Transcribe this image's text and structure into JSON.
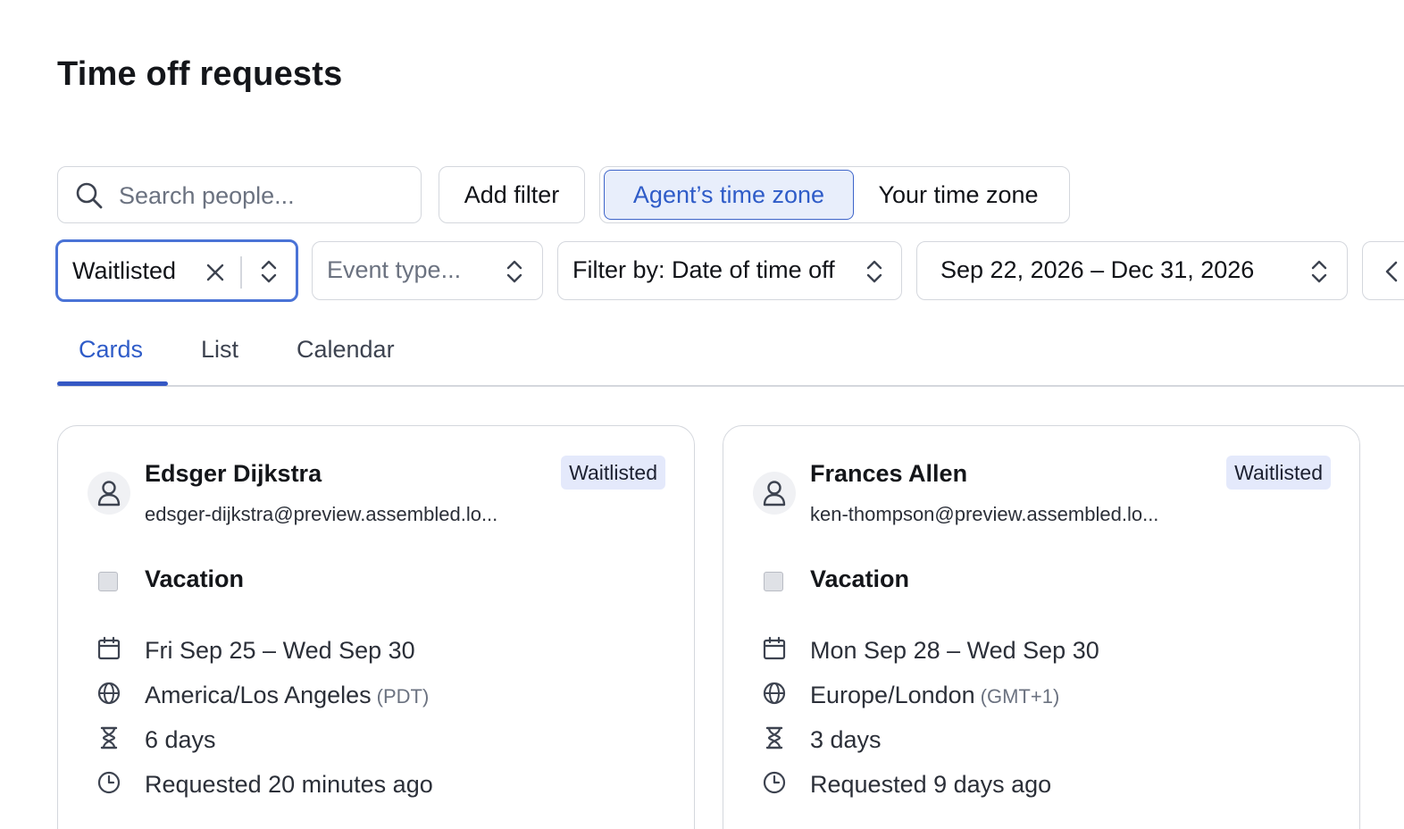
{
  "page": {
    "title": "Time off requests"
  },
  "toolbar": {
    "search_placeholder": "Search people...",
    "search_value": "",
    "add_filter_label": "Add filter",
    "timezone_options": [
      "Agent’s time zone",
      "Your time zone"
    ],
    "timezone_selected": "Agent’s time zone"
  },
  "filters": {
    "status_value": "Waitlisted",
    "event_type_placeholder": "Event type...",
    "filter_by_value": "Filter by: Date of time off",
    "date_range_value": "Sep 22, 2026 – Dec 31, 2026"
  },
  "tabs": [
    {
      "label": "Cards",
      "active": true
    },
    {
      "label": "List",
      "active": false
    },
    {
      "label": "Calendar",
      "active": false
    }
  ],
  "cards": [
    {
      "name": "Edsger Dijkstra",
      "email": "edsger-dijkstra@preview.assembled.lo...",
      "status": "Waitlisted",
      "type": "Vacation",
      "dates": "Fri Sep 25 – Wed Sep 30",
      "timezone": "America/Los Angeles",
      "timezone_abbr": "(PDT)",
      "duration": "6 days",
      "requested": "Requested 20 minutes ago"
    },
    {
      "name": "Frances Allen",
      "email": "ken-thompson@preview.assembled.lo...",
      "status": "Waitlisted",
      "type": "Vacation",
      "dates": "Mon Sep 28 – Wed Sep 30",
      "timezone": "Europe/London",
      "timezone_abbr": "(GMT+1)",
      "duration": "3 days",
      "requested": "Requested 9 days ago"
    }
  ],
  "colors": {
    "accent": "#2f5cc8",
    "accent_bg": "#e8eefb",
    "badge_bg": "#e4e9fb",
    "border": "#d4d7dd"
  }
}
